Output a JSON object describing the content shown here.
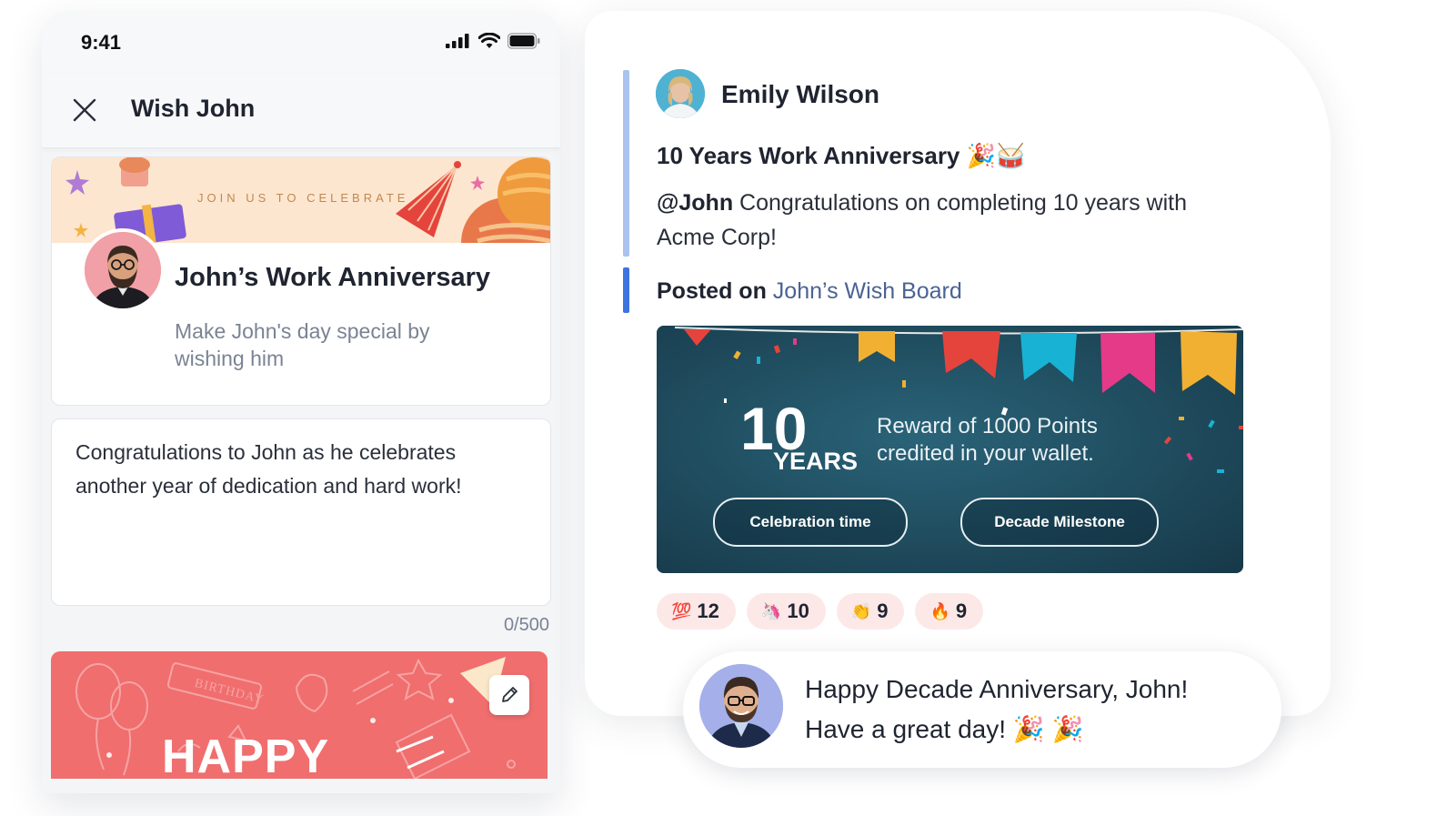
{
  "phone": {
    "status": {
      "time": "9:41"
    },
    "appbar": {
      "title": "Wish John"
    },
    "wish_card": {
      "banner_text": "JOIN US TO CELEBRATE",
      "title": "John’s Work Anniversary",
      "subtitle": "Make John's day special by wishing him"
    },
    "message": {
      "text": "Congratulations to John as he celebrates another year of dedication and hard work!",
      "counter": "0/500"
    },
    "card_preview": {
      "happy_text": "HAPPY",
      "balloon_text": "BIRTHDAY"
    }
  },
  "post": {
    "author": "Emily Wilson",
    "title": "10 Years Work Anniversary 🎉🥁",
    "mention": "@John",
    "body": " Congratulations on completing 10 years with Acme Corp!",
    "posted_on_label": "Posted on",
    "board_name": "John’s Wish Board",
    "reward": {
      "logo_number": "10",
      "logo_word": "YEARS",
      "text": "Reward of 1000 Points credited in your wallet.",
      "buttons": [
        "Celebration time",
        "Decade Milestone"
      ]
    },
    "reactions": [
      {
        "emoji": "💯",
        "count": "12"
      },
      {
        "emoji": "🦄",
        "count": "10"
      },
      {
        "emoji": "👏",
        "count": "9"
      },
      {
        "emoji": "🔥",
        "count": "9"
      }
    ]
  },
  "comment": {
    "text": "Happy Decade Anniversary, John! Have a great day! 🎉 🎉"
  },
  "colors": {
    "accent_light": "#a9c3ee",
    "accent": "#3d74e0",
    "reaction_bg": "#fde8e8",
    "reward_bg": "#1f4a5c",
    "happy_card": "#f06e6e"
  }
}
